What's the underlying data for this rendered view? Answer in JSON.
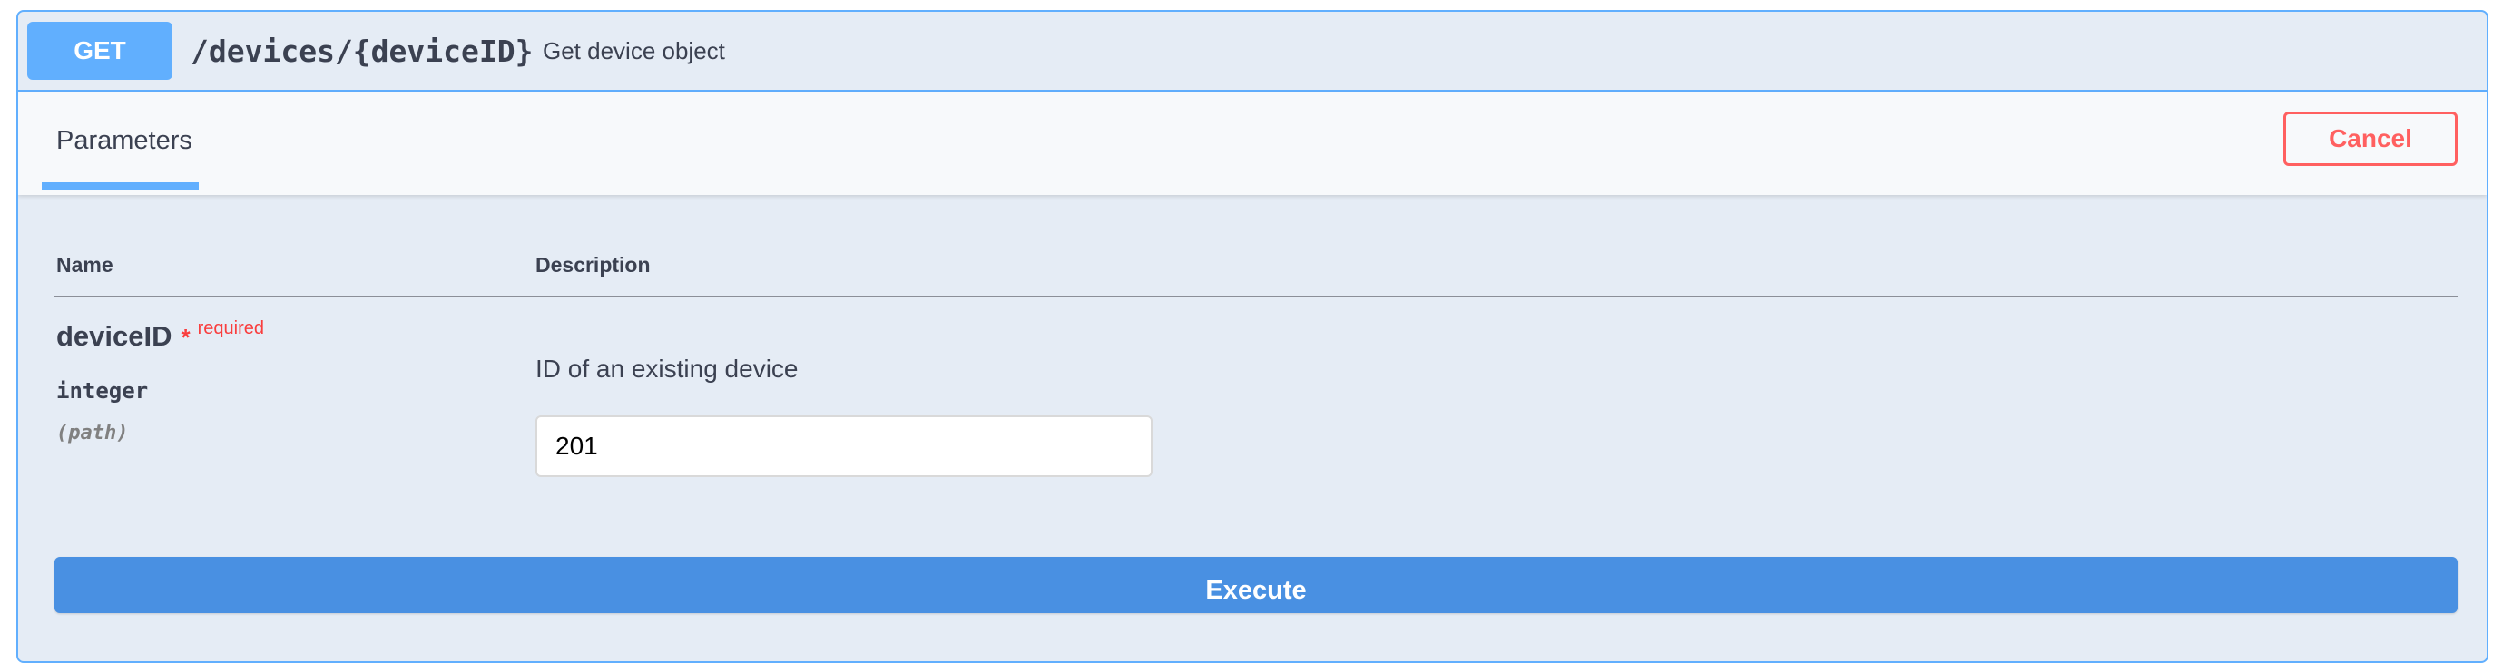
{
  "operation": {
    "method": "GET",
    "path": "/devices/{deviceID}",
    "summary": "Get device object"
  },
  "section_header": {
    "tab_label": "Parameters",
    "cancel_label": "Cancel"
  },
  "parameters_table": {
    "headers": [
      "Name",
      "Description"
    ],
    "rows": [
      {
        "name": "deviceID",
        "required_marker": "*",
        "required_label": "required",
        "type": "integer",
        "location": "(path)",
        "description": "ID of an existing device",
        "value": "201"
      }
    ]
  },
  "actions": {
    "execute_label": "Execute"
  },
  "colors": {
    "get_blue": "#61affe",
    "execute_blue": "#4990e2",
    "cancel_red": "#ff6060",
    "required_red": "#f93e3e",
    "block_background": "#e5ecf5"
  }
}
